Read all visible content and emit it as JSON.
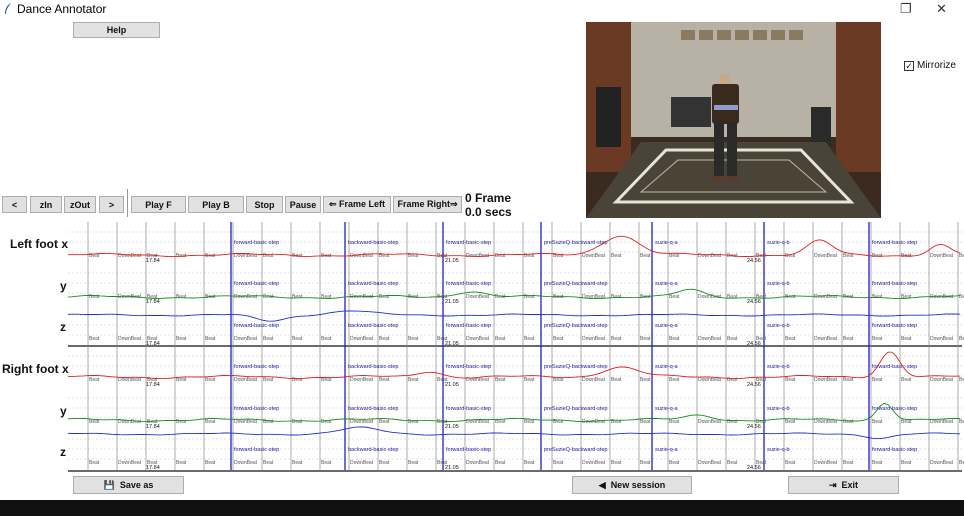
{
  "window": {
    "title": "Dance Annotator",
    "restore_icon": "❐",
    "close_icon": "✕"
  },
  "toolbar": {
    "help": "Help",
    "prev": "<",
    "zoom_in": "zIn",
    "zoom_out": "zOut",
    "next": ">",
    "play_forward": "Play F",
    "play_backward": "Play B",
    "stop": "Stop",
    "pause": "Pause",
    "frame_left": "⇐ Frame Left",
    "frame_right": "Frame Right⇒"
  },
  "status": {
    "frame": "0 Frame",
    "secs": "0.0 secs"
  },
  "options": {
    "mirrorize_label": "Mirrorize",
    "mirrorize_checked": true
  },
  "rows": {
    "left_x": "Left foot x",
    "left_y": "y",
    "left_z": "z",
    "right_x": "Right foot x",
    "right_y": "y",
    "right_z": "z"
  },
  "annotations": {
    "steps": [
      "forward-basic-step",
      "backward-basic-step",
      "forward-basic-step",
      "preSuzieQ-backward-step",
      "suzie-q-a",
      "suzie-q-b",
      "forward-basic-step"
    ],
    "times": [
      "17.84",
      "21.05",
      "24.56"
    ],
    "beat_label": "Beat",
    "downbeat_label": "DownBeat"
  },
  "footer": {
    "save_as": "Save as",
    "new_session": "New session",
    "exit": "Exit"
  },
  "colors": {
    "x_series": "#e02020",
    "y_series": "#1a8a1a",
    "z_series": "#2030d0",
    "segment_line": "#2020c0",
    "beat_line": "#888888"
  }
}
